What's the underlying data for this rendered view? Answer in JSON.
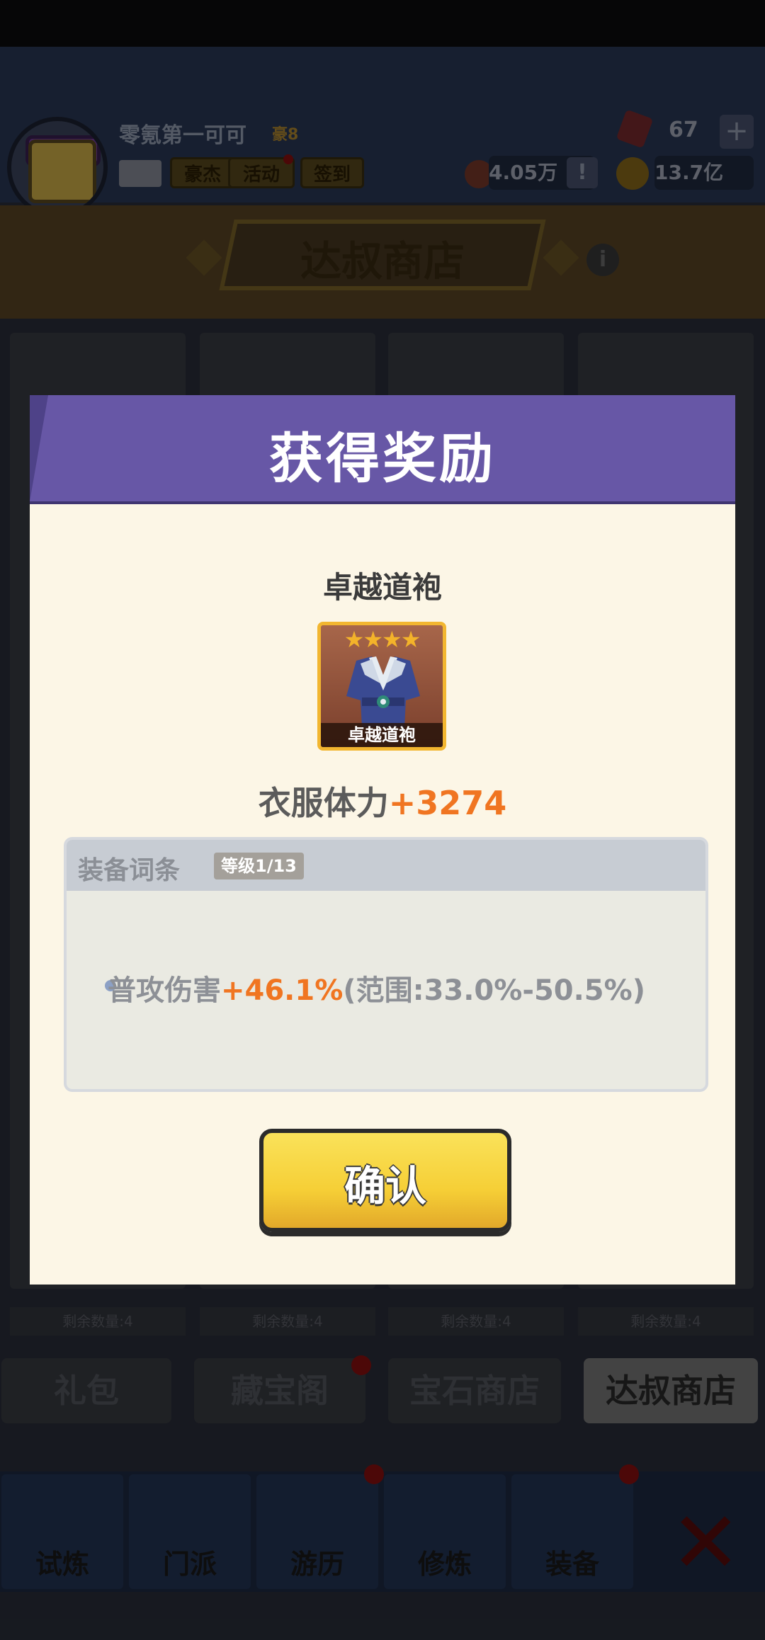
{
  "header": {
    "player_name": "零氪第一可可",
    "vip_label": "豪8",
    "buttons": [
      "豪杰",
      "活动",
      "签到"
    ],
    "gems": "67",
    "power": "4.05万",
    "gold": "13.7亿"
  },
  "shop": {
    "title": "达叔商店",
    "remaining": [
      "剩余数量:4",
      "剩余数量:4",
      "剩余数量:4",
      "剩余数量:4"
    ]
  },
  "shop_tabs": [
    {
      "label": "礼包"
    },
    {
      "label": "藏宝阁"
    },
    {
      "label": "宝石商店"
    },
    {
      "label": "达叔商店"
    }
  ],
  "nav": [
    {
      "label": "试炼"
    },
    {
      "label": "门派"
    },
    {
      "label": "游历"
    },
    {
      "label": "修炼"
    },
    {
      "label": "装备"
    }
  ],
  "dialog": {
    "title": "获得奖励",
    "item_name": "卓越道袍",
    "item_caption": "卓越道袍",
    "stars": "★★★★",
    "stat_label": "衣服体力",
    "stat_value": "+3274",
    "affix_title": "装备词条",
    "affix_level": "等级1/13",
    "affix_name": "普攻伤害",
    "affix_value": "+46.1%",
    "affix_range": "(范围:33.0%-50.5%)",
    "confirm": "确认"
  },
  "colors": {
    "header_purple": "#6757a6",
    "panel_cream": "#fcf6e6",
    "highlight_orange": "#f07521",
    "button_yellow": "#f6cf36"
  }
}
